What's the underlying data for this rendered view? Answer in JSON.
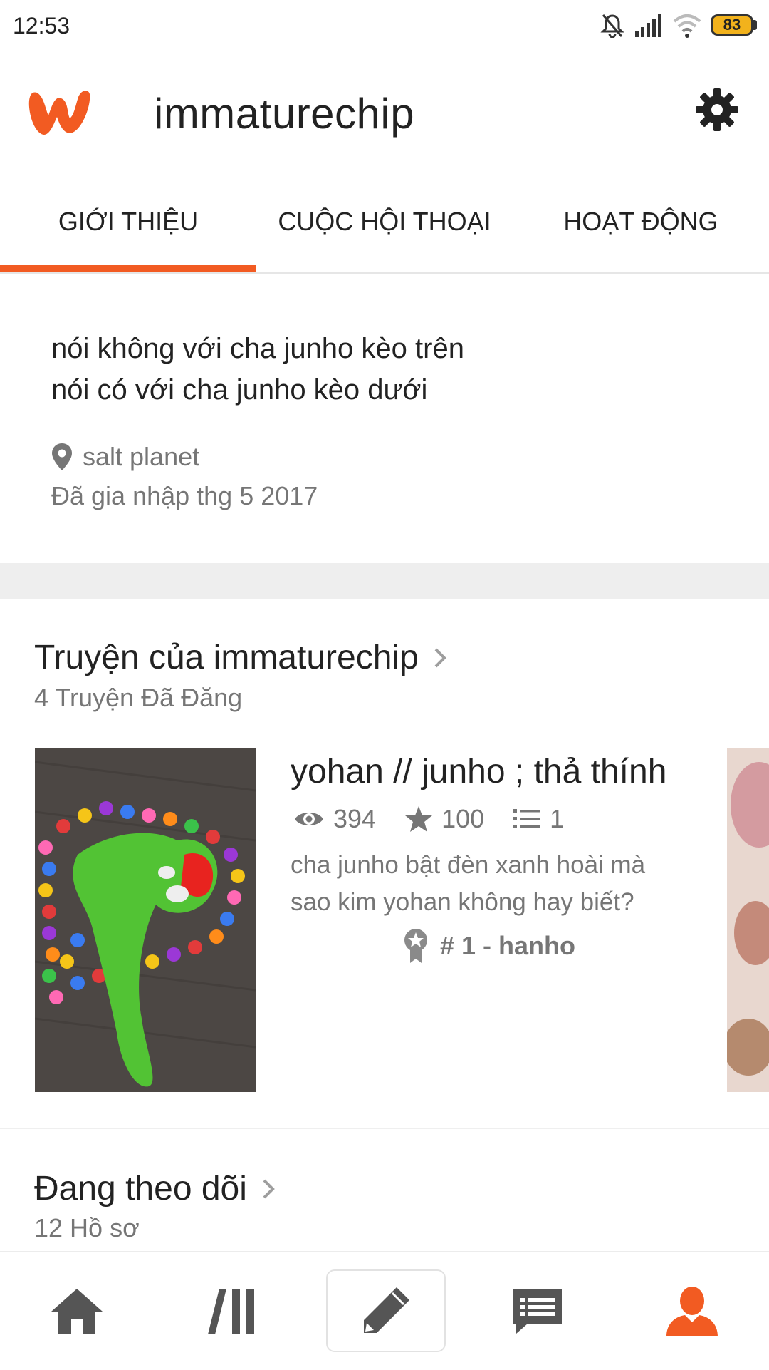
{
  "status_bar": {
    "time": "12:53",
    "battery": "83"
  },
  "header": {
    "username": "immaturechip"
  },
  "tabs": [
    {
      "label": "GIỚI THIỆU",
      "active": true
    },
    {
      "label": "CUỘC HỘI THOẠI",
      "active": false
    },
    {
      "label": "HOẠT ĐỘNG",
      "active": false
    }
  ],
  "about": {
    "bio_line1": "nói không với cha junho kèo trên",
    "bio_line2": "nói có với cha junho kèo dưới",
    "location": "salt planet",
    "joined": "Đã gia nhập thg 5 2017"
  },
  "stories": {
    "title": "Truyện của immaturechip",
    "count": "4 Truyện Đã Đăng",
    "items": [
      {
        "title": "yohan // junho ; thả thính",
        "views": "394",
        "votes": "100",
        "parts": "1",
        "description": "cha junho bật đèn xanh hoài mà sao kim yohan không hay biết?",
        "rank": "# 1 - hanho"
      }
    ]
  },
  "following": {
    "title": "Đang theo dõi",
    "count": "12 Hồ sơ"
  },
  "bottom_nav": [
    "home-icon",
    "library-icon",
    "write-icon",
    "messages-icon",
    "profile-icon"
  ],
  "colors": {
    "accent": "#f25b22",
    "text": "#222222",
    "secondary": "#767676"
  }
}
